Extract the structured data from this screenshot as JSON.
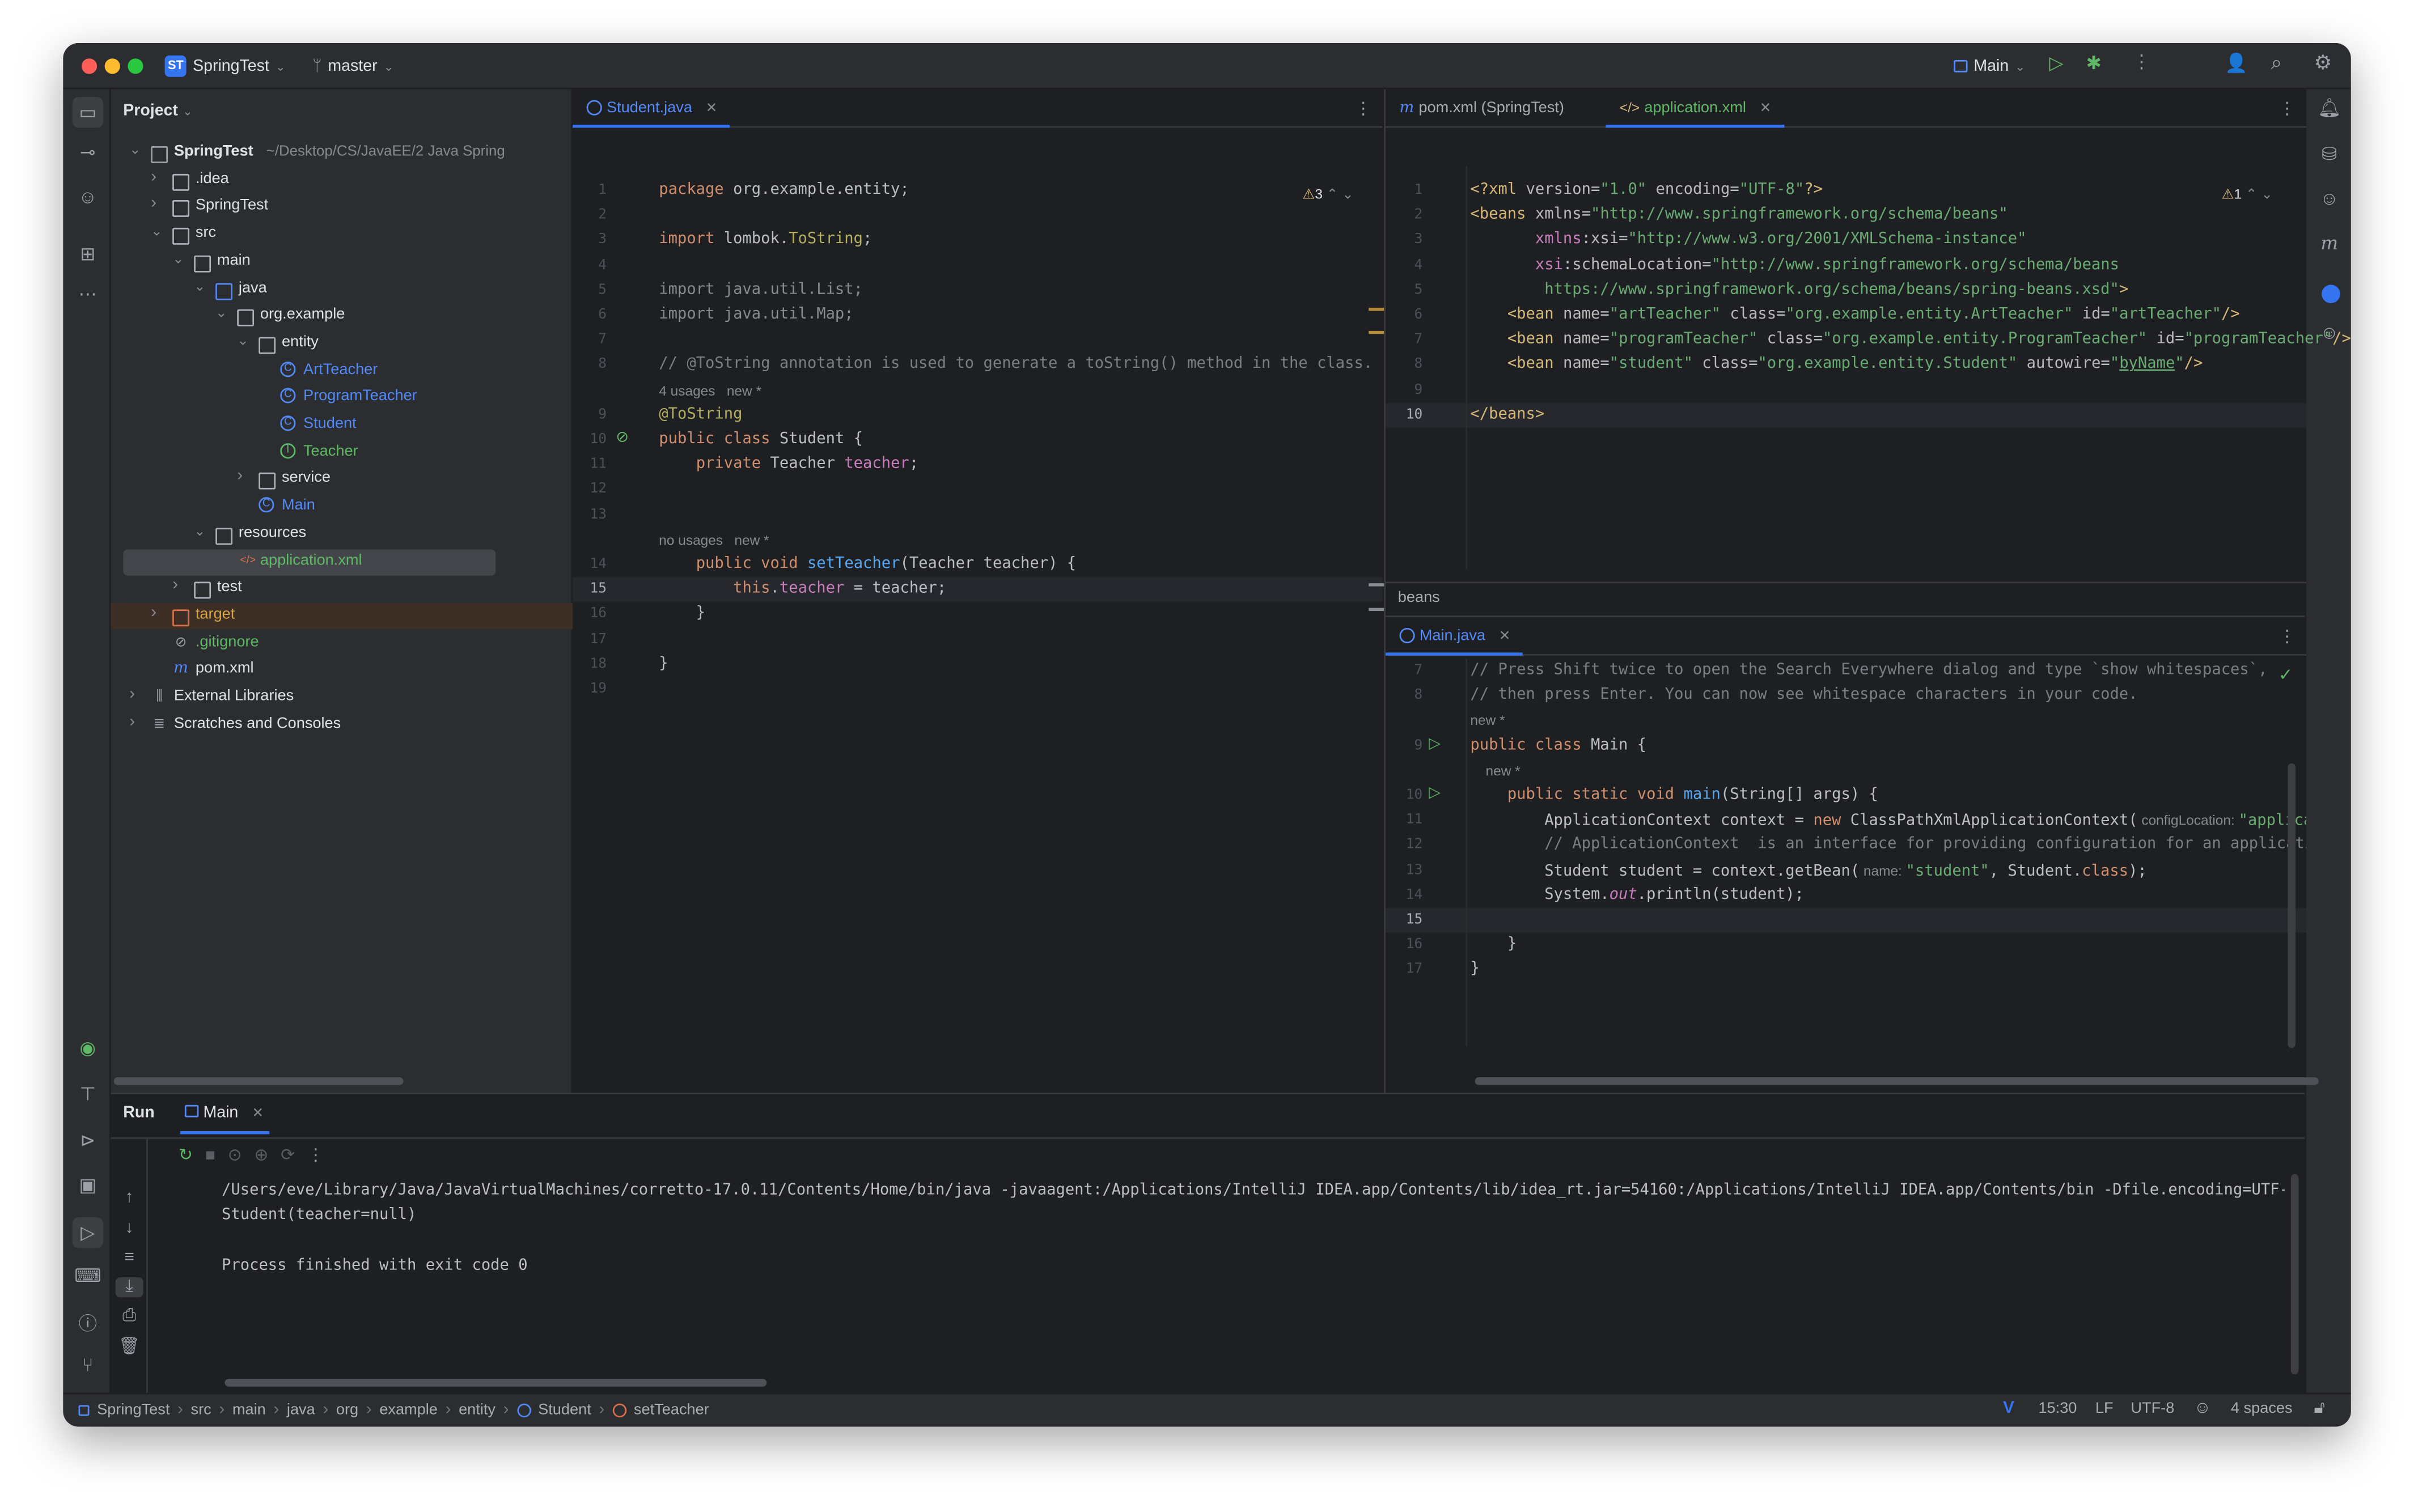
{
  "window": {
    "project_badge": "ST",
    "project_name": "SpringTest",
    "branch": "master",
    "run_config": "Main"
  },
  "project_panel": {
    "title": "Project",
    "tree": [
      {
        "label": "SpringTest",
        "suffix": "~/Desktop/CS/JavaEE/2 Java Spring",
        "depth": 0,
        "icon": "module-folder",
        "expanded": true
      },
      {
        "label": ".idea",
        "depth": 1,
        "icon": "folder",
        "expanded": false
      },
      {
        "label": "SpringTest",
        "depth": 1,
        "icon": "folder",
        "expanded": false
      },
      {
        "label": "src",
        "depth": 1,
        "icon": "folder",
        "expanded": true
      },
      {
        "label": "main",
        "depth": 2,
        "icon": "folder",
        "expanded": true
      },
      {
        "label": "java",
        "depth": 3,
        "icon": "source-folder",
        "expanded": true
      },
      {
        "label": "org.example",
        "depth": 4,
        "icon": "package",
        "expanded": true
      },
      {
        "label": "entity",
        "depth": 5,
        "icon": "package",
        "expanded": true
      },
      {
        "label": "ArtTeacher",
        "depth": 6,
        "icon": "class",
        "color": "#548af7"
      },
      {
        "label": "ProgramTeacher",
        "depth": 6,
        "icon": "class",
        "color": "#548af7"
      },
      {
        "label": "Student",
        "depth": 6,
        "icon": "class",
        "color": "#548af7"
      },
      {
        "label": "Teacher",
        "depth": 6,
        "icon": "interface",
        "color": "#5fb865"
      },
      {
        "label": "service",
        "depth": 5,
        "icon": "package",
        "expanded": false
      },
      {
        "label": "Main",
        "depth": 5,
        "icon": "class",
        "color": "#548af7"
      },
      {
        "label": "resources",
        "depth": 3,
        "icon": "resources-folder",
        "expanded": true
      },
      {
        "label": "application.xml",
        "depth": 4,
        "icon": "xml",
        "color": "#5fb865",
        "selected": true
      },
      {
        "label": "test",
        "depth": 2,
        "icon": "folder",
        "expanded": false
      },
      {
        "label": "target",
        "depth": 1,
        "icon": "excluded-folder",
        "expanded": false,
        "color": "#d9a343",
        "highlight": true
      },
      {
        "label": ".gitignore",
        "depth": 1,
        "icon": "ignore",
        "color": "#5fb865"
      },
      {
        "label": "pom.xml",
        "depth": 1,
        "icon": "maven"
      },
      {
        "label": "External Libraries",
        "depth": 0,
        "icon": "library",
        "expanded": false
      },
      {
        "label": "Scratches and Consoles",
        "depth": 0,
        "icon": "scratch",
        "expanded": false
      }
    ]
  },
  "left_editor": {
    "tab": "Student.java",
    "warnings": "3",
    "lines": [
      {
        "n": "1",
        "html": "<span class='kw'>package</span> org.example.entity;"
      },
      {
        "n": "2",
        "html": ""
      },
      {
        "n": "3",
        "html": "<span class='kw'>import</span> lombok.<span class='ann'>ToString</span>;"
      },
      {
        "n": "4",
        "html": ""
      },
      {
        "n": "5",
        "html": "<span class='gray'>import java.util.List;</span>"
      },
      {
        "n": "6",
        "html": "<span class='gray'>import java.util.Map;</span>"
      },
      {
        "n": "7",
        "html": ""
      },
      {
        "n": "8",
        "html": "<span class='cmt'>// @ToString annotation is used to generate a toString() method in the class.</span>"
      },
      {
        "n": "",
        "hint": "4 usages   new *"
      },
      {
        "n": "9",
        "html": "<span class='ann'>@ToString</span>"
      },
      {
        "n": "10",
        "html": "<span class='kw'>public class</span> Student {"
      },
      {
        "n": "11",
        "html": "    <span class='kw'>private</span> Teacher <span class='fld'>teacher</span>;"
      },
      {
        "n": "12",
        "html": ""
      },
      {
        "n": "13",
        "html": ""
      },
      {
        "n": "",
        "hint": "no usages   new *"
      },
      {
        "n": "14",
        "html": "    <span class='kw'>public void</span> <span class='fn'>setTeacher</span>(Teacher teacher) {"
      },
      {
        "n": "15",
        "html": "        <span class='kw'>this</span>.<span class='fld'>teacher</span> = teacher;",
        "current": true
      },
      {
        "n": "16",
        "html": "    }"
      },
      {
        "n": "17",
        "html": ""
      },
      {
        "n": "18",
        "html": "}"
      },
      {
        "n": "19",
        "html": ""
      }
    ]
  },
  "right_top_editor": {
    "tabs": [
      "pom.xml (SpringTest)",
      "application.xml"
    ],
    "warnings": "1",
    "breadcrumb": "beans",
    "lines": [
      {
        "n": "1",
        "html": "<span class='tag'>&lt;?xml</span> <span class='attr'>version</span>=<span class='str'>\"1.0\"</span> <span class='attr'>encoding</span>=<span class='str'>\"UTF-8\"</span><span class='tag'>?&gt;</span>"
      },
      {
        "n": "2",
        "html": "<span class='tag'>&lt;beans</span> <span class='attr'>xmlns</span>=<span class='str'>\"http://www.springframework.org/schema/beans\"</span>"
      },
      {
        "n": "3",
        "html": "       <span class='ns'>xmlns</span>:<span class='attr'>xsi</span>=<span class='str'>\"http://www.w3.org/2001/XMLSchema-instance\"</span>"
      },
      {
        "n": "4",
        "html": "       <span class='ns'>xsi</span>:<span class='attr'>schemaLocation</span>=<span class='str'>\"http://www.springframework.org/schema/beans</span>"
      },
      {
        "n": "5",
        "html": "<span class='str'>        https://www.springframework.org/schema/beans/spring-beans.xsd\"</span><span class='tag'>&gt;</span>"
      },
      {
        "n": "6",
        "html": "    <span class='tag'>&lt;bean</span> <span class='attr'>name</span>=<span class='str'>\"artTeacher\"</span> <span class='attr'>class</span>=<span class='str'>\"org.example.entity.ArtTeacher\"</span> <span class='attr'>id</span>=<span class='str'>\"artTeacher\"</span><span class='tag'>/&gt;</span>"
      },
      {
        "n": "7",
        "html": "    <span class='tag'>&lt;bean</span> <span class='attr'>name</span>=<span class='str'>\"programTeacher\"</span> <span class='attr'>class</span>=<span class='str'>\"org.example.entity.ProgramTeacher\"</span> <span class='attr'>id</span>=<span class='str'>\"programTeacher\"</span><span class='tag'>/&gt;</span>"
      },
      {
        "n": "8",
        "html": "    <span class='tag'>&lt;bean</span> <span class='attr'>name</span>=<span class='str'>\"student\"</span> <span class='attr'>class</span>=<span class='str'>\"org.example.entity.Student\"</span> <span class='attr'>autowire</span>=<span class='str'>\"<u>byName</u>\"</span><span class='tag'>/&gt;</span>"
      },
      {
        "n": "9",
        "html": ""
      },
      {
        "n": "10",
        "html": "<span class='tag'>&lt;/beans&gt;</span>",
        "current": true
      }
    ]
  },
  "right_bottom_editor": {
    "tab": "Main.java",
    "lines": [
      {
        "n": "7",
        "html": "<span class='cmt'>// Press Shift twice to open the Search Everywhere dialog and type `show whitespaces`,</span>"
      },
      {
        "n": "8",
        "html": "<span class='cmt'>// then press Enter. You can now see whitespace characters in your code.</span>"
      },
      {
        "n": "",
        "hint": "new *"
      },
      {
        "n": "9",
        "html": "<span class='kw'>public class</span> Main {",
        "run": true
      },
      {
        "n": "",
        "hint": "    new *"
      },
      {
        "n": "10",
        "html": "    <span class='kw'>public static void</span> <span class='fn'>main</span>(String[] args) {",
        "run": true
      },
      {
        "n": "11",
        "html": "        ApplicationContext context = <span class='kw'>new</span> ClassPathXmlApplicationContext(<span class='hint'> configLocation: </span><span class='str'>\"application.xml\"</span>"
      },
      {
        "n": "12",
        "html": "        <span class='cmt'>// ApplicationContext  is an interface for providing configuration for an application.</span>"
      },
      {
        "n": "13",
        "html": "        Student student = context.getBean(<span class='hint'> name: </span><span class='str'>\"student\"</span>, Student.<span class='kw'>class</span>);"
      },
      {
        "n": "14",
        "html": "        System.<span class='fld'><i>out</i></span>.println(student);"
      },
      {
        "n": "15",
        "html": "",
        "current": true
      },
      {
        "n": "16",
        "html": "    }"
      },
      {
        "n": "17",
        "html": "}"
      }
    ]
  },
  "run_panel": {
    "title": "Run",
    "tab": "Main",
    "output": [
      "/Users/eve/Library/Java/JavaVirtualMachines/corretto-17.0.11/Contents/Home/bin/java -javaagent:/Applications/IntelliJ IDEA.app/Contents/lib/idea_rt.jar=54160:/Applications/IntelliJ IDEA.app/Contents/bin -Dfile.encoding=UTF-8 -classpath /User",
      "Student(teacher=null)",
      "",
      "Process finished with exit code 0"
    ]
  },
  "status_bar": {
    "breadcrumbs": [
      "SpringTest",
      "src",
      "main",
      "java",
      "org",
      "example",
      "entity",
      "Student",
      "setTeacher"
    ],
    "position": "15:30",
    "line_sep": "LF",
    "encoding": "UTF-8",
    "indent": "4 spaces"
  }
}
